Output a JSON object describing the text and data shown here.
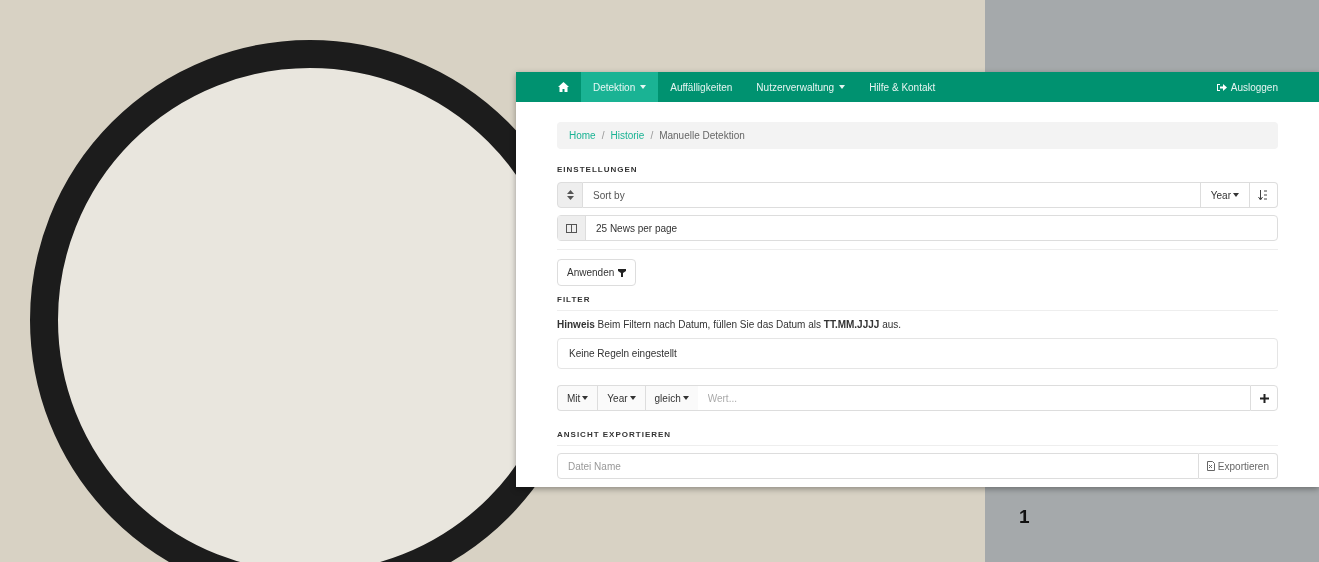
{
  "figure_label": "1",
  "app": {
    "nav": {
      "items": [
        {
          "kind": "home",
          "selected": false
        },
        {
          "kind": "link",
          "label": "Detektion",
          "dropdown": true,
          "selected": true
        },
        {
          "kind": "link",
          "label": "Auffälligkeiten",
          "dropdown": false,
          "selected": false
        },
        {
          "kind": "link",
          "label": "Nutzerverwaltung",
          "dropdown": true,
          "selected": false
        },
        {
          "kind": "link",
          "label": "Hilfe & Kontakt",
          "dropdown": false,
          "selected": false
        }
      ],
      "logout": "Ausloggen"
    },
    "breadcrumb_separator": "/",
    "breadcrumb": [
      {
        "label": "Home",
        "link": true
      },
      {
        "label": "Historie",
        "link": true
      },
      {
        "label": "Manuelle Detektion",
        "link": false
      }
    ],
    "settings": {
      "heading": "EINSTELLUNGEN",
      "sort": {
        "placeholder": "Sort by",
        "field": "Year"
      },
      "per_page": "25 News per page",
      "apply": "Anwenden"
    },
    "filter": {
      "heading": "FILTER",
      "hint": "**Hinweis** Beim Filtern nach Datum, füllen Sie das Datum als **TT.MM.JJJJ** aus.",
      "rules_empty": "Keine Regeln eingestellt",
      "selects": [
        "Mit",
        "Year",
        "gleich"
      ],
      "value_placeholder": "Wert..."
    },
    "export": {
      "heading": "ANSICHT EXPORTIEREN",
      "placeholder": "Datei Name",
      "button": "Exportieren"
    }
  }
}
